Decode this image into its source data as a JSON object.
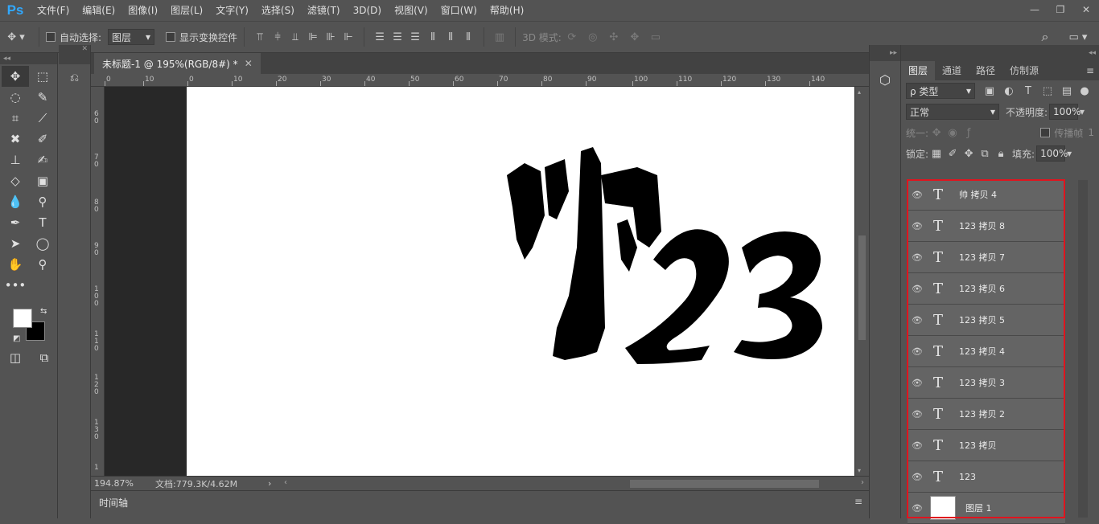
{
  "menubar": {
    "logo": "Ps",
    "items": [
      "文件(F)",
      "编辑(E)",
      "图像(I)",
      "图层(L)",
      "文字(Y)",
      "选择(S)",
      "滤镜(T)",
      "3D(D)",
      "视图(V)",
      "窗口(W)",
      "帮助(H)"
    ]
  },
  "options": {
    "auto_select_label": "自动选择:",
    "auto_select_value": "图层",
    "show_transform_label": "显示变换控件",
    "mode_3d_label": "3D 模式:"
  },
  "document": {
    "tab_title": "未标题-1 @ 195%(RGB/8#) *",
    "zoom": "194.87%",
    "doc_info": "文档:779.3K/4.62M",
    "timeline_label": "时间轴",
    "ruler_top": [
      "0",
      "10",
      "0",
      "10",
      "20",
      "30",
      "40",
      "50",
      "60",
      "70",
      "80",
      "90",
      "100",
      "110",
      "120",
      "130",
      "140"
    ],
    "ruler_left": [
      "6 0",
      "7 0",
      "8 0",
      "9 0",
      "1 0 0",
      "1 1 0",
      "1 2 0",
      "1 3 0",
      "1"
    ]
  },
  "layers_panel": {
    "tabs": [
      "图层",
      "通道",
      "路径",
      "仿制源"
    ],
    "filter_label": "ρ 类型",
    "blend_mode": "正常",
    "opacity_label": "不透明度:",
    "opacity_value": "100%",
    "unify_label": "统一:",
    "propagate_label": "传播帧",
    "propagate_value": "1",
    "lock_label": "锁定:",
    "fill_label": "填充:",
    "fill_value": "100%",
    "layers": [
      {
        "name": "帅 拷贝 4",
        "type": "text"
      },
      {
        "name": "123 拷贝 8",
        "type": "text"
      },
      {
        "name": "123 拷贝 7",
        "type": "text"
      },
      {
        "name": "123 拷贝 6",
        "type": "text"
      },
      {
        "name": "123 拷贝 5",
        "type": "text"
      },
      {
        "name": "123 拷贝 4",
        "type": "text"
      },
      {
        "name": "123 拷贝 3",
        "type": "text"
      },
      {
        "name": "123 拷贝 2",
        "type": "text"
      },
      {
        "name": "123 拷贝",
        "type": "text"
      },
      {
        "name": "123",
        "type": "text"
      },
      {
        "name": "图层 1",
        "type": "image"
      }
    ],
    "text_layer_glyph": "T",
    "highlight_color": "#e0141e"
  },
  "colors": {
    "accent": "#31a8ff",
    "foreground": "#ffffff",
    "background": "#000000"
  }
}
